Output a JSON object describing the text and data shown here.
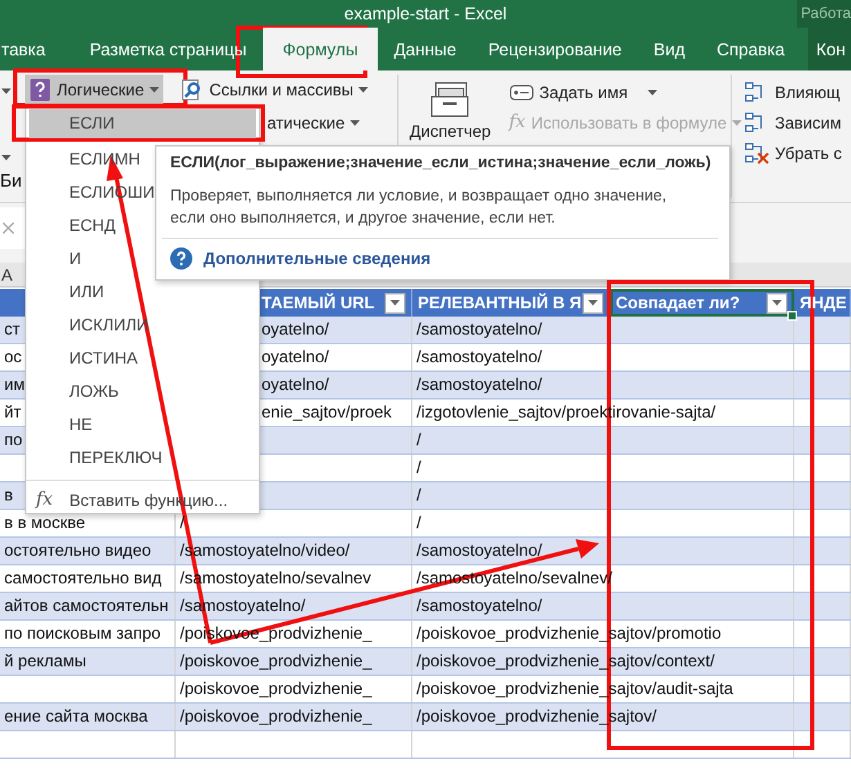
{
  "window": {
    "title": "example-start  -  Excel",
    "context_label": "Работа"
  },
  "ribbon_tabs": [
    {
      "label": "тавка",
      "selected": false,
      "kind": "normal"
    },
    {
      "label": "Разметка страницы",
      "selected": false,
      "kind": "normal"
    },
    {
      "label": "Формулы",
      "selected": true,
      "kind": "normal"
    },
    {
      "label": "Данные",
      "selected": false,
      "kind": "normal"
    },
    {
      "label": "Рецензирование",
      "selected": false,
      "kind": "normal"
    },
    {
      "label": "Вид",
      "selected": false,
      "kind": "normal"
    },
    {
      "label": "Справка",
      "selected": false,
      "kind": "normal"
    },
    {
      "label": "Кон",
      "selected": false,
      "kind": "contextual"
    }
  ],
  "ribbon": {
    "left_fragment": "Би",
    "logical_button": {
      "label": "Логические",
      "pressed": true
    },
    "lookup_button": "Ссылки и массивы",
    "math_button_fragment": "атические",
    "name_manager": "Диспетчер",
    "define_name": "Задать имя",
    "use_in_formula": {
      "icon": "fx",
      "label": "Использовать в формуле",
      "disabled": true
    },
    "auditing": [
      "Влияющ",
      "Зависим",
      "Убрать с"
    ]
  },
  "function_menu": {
    "items": [
      {
        "label": "ЕСЛИ",
        "selected": true
      },
      {
        "label": "ЕСЛИМН",
        "selected": false
      },
      {
        "label": "ЕСЛИОШИ",
        "selected": false
      },
      {
        "label": "ЕСНД",
        "selected": false
      },
      {
        "label": "И",
        "selected": false
      },
      {
        "label": "ИЛИ",
        "selected": false
      },
      {
        "label": "ИСКЛИЛИ",
        "selected": false
      },
      {
        "label": "ИСТИНА",
        "selected": false
      },
      {
        "label": "ЛОЖЬ",
        "selected": false
      },
      {
        "label": "НЕ",
        "selected": false
      },
      {
        "label": "ПЕРЕКЛЮЧ",
        "selected": false
      }
    ],
    "insert_function": {
      "icon": "fx",
      "label": "Вставить функцию..."
    }
  },
  "tooltip": {
    "signature": "ЕСЛИ(лог_выражение;значение_если_истина;значение_если_ложь)",
    "description": "Проверяет, выполняется ли условие, и возвращает одно значение, если оно выполняется, и другое значение, если нет.",
    "more_info": "Дополнительные сведения"
  },
  "sheet": {
    "column_letter": "A"
  },
  "table": {
    "columns": [
      {},
      {
        "label": "ТАЕМЫЙ URL",
        "selected": false,
        "filter": true
      },
      {
        "label": "РЕЛЕВАНТНЫЙ В Я",
        "selected": false,
        "filter": true
      },
      {
        "label": "Совпадает ли?",
        "selected": true,
        "filter": true
      },
      {
        "label": "ЯНДЕ",
        "selected": false,
        "filter": false
      }
    ],
    "rows": [
      {
        "cells": [
          "ст",
          "oyatelno/",
          "/samostoyatelno/"
        ]
      },
      {
        "cells": [
          "ос",
          "oyatelno/",
          "/samostoyatelno/"
        ]
      },
      {
        "cells": [
          "им",
          "oyatelno/",
          "/samostoyatelno/"
        ]
      },
      {
        "cells": [
          "йт",
          "enie_sajtov/proek",
          "/izgotovlenie_sajtov/proektirovanie-sajta/"
        ]
      },
      {
        "cells": [
          "по",
          "",
          "/"
        ]
      },
      {
        "cells": [
          "",
          "",
          "/"
        ]
      },
      {
        "cells": [
          "в",
          "",
          "/"
        ]
      },
      {
        "cells": [
          "в в москве",
          "/",
          "/"
        ]
      },
      {
        "cells": [
          "остоятельно видео",
          "/samostoyatelno/video/",
          "/samostoyatelno/"
        ]
      },
      {
        "cells": [
          "самостоятельно вид",
          "/samostoyatelno/sevalnev",
          "/samostoyatelno/sevalnev/"
        ]
      },
      {
        "cells": [
          "айтов самостоятельн",
          "/samostoyatelno/",
          "/samostoyatelno/"
        ]
      },
      {
        "cells": [
          "по поисковым запро",
          "/poiskovoe_prodvizhenie_",
          "/poiskovoe_prodvizhenie_sajtov/promotio"
        ]
      },
      {
        "cells": [
          "й рекламы",
          "/poiskovoe_prodvizhenie_",
          "/poiskovoe_prodvizhenie_sajtov/context/"
        ]
      },
      {
        "cells": [
          "",
          "/poiskovoe_prodvizhenie_",
          "/poiskovoe_prodvizhenie_sajtov/audit-sajta"
        ]
      },
      {
        "cells": [
          "ение сайта москва",
          "/poiskovoe_prodvizhenie_",
          "/poiskovoe_prodvizhenie_sajtov/"
        ]
      }
    ]
  }
}
